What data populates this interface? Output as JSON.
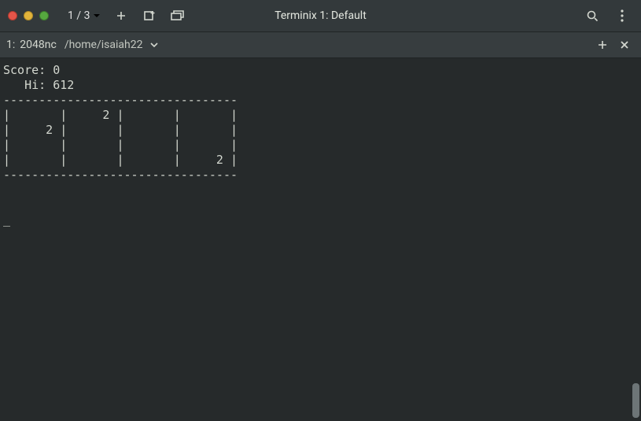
{
  "titlebar": {
    "page_indicator": "1 / 3",
    "title": "Terminix 1: Default"
  },
  "tab": {
    "index": "1:",
    "process": "2048nc",
    "path": "/home/isaiah22"
  },
  "game": {
    "score_label": "Score:",
    "score_value": "0",
    "hi_label": "Hi:",
    "hi_value": "612",
    "rows": [
      [
        "",
        "2",
        "",
        ""
      ],
      [
        "2",
        "",
        "",
        ""
      ],
      [
        "",
        "",
        "",
        ""
      ],
      [
        "",
        "",
        "",
        "2"
      ]
    ]
  }
}
